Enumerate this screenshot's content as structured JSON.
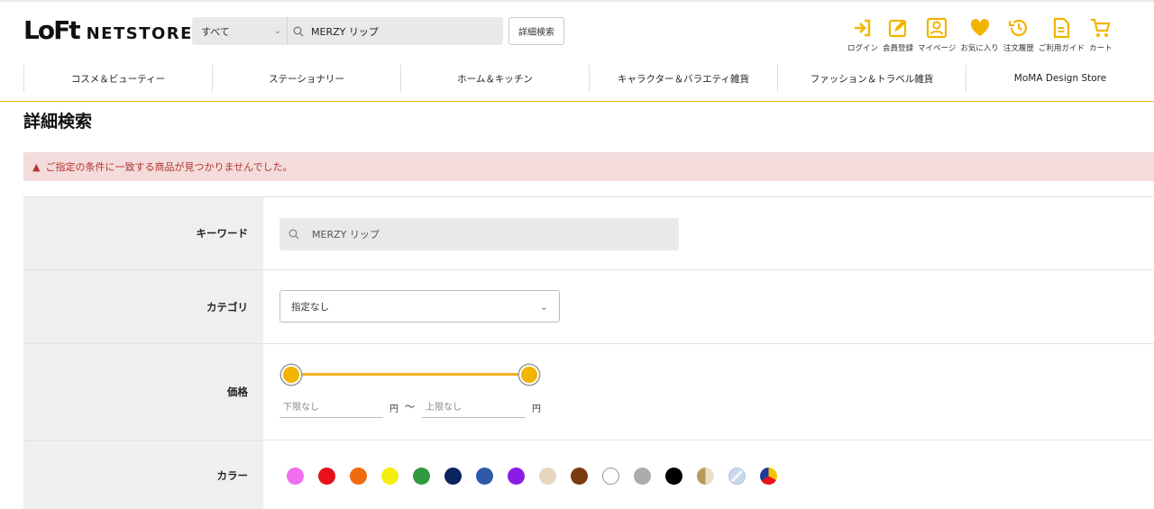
{
  "header": {
    "logo_mark": "LoFt",
    "logo_text": "NETSTORE",
    "search_scope": "すべて",
    "search_value": "MERZY リップ",
    "advanced_button": "詳細検索",
    "icons": [
      {
        "name": "login-icon",
        "label": "ログイン"
      },
      {
        "name": "register-icon",
        "label": "会員登録"
      },
      {
        "name": "mypage-icon",
        "label": "マイページ"
      },
      {
        "name": "favorite-icon",
        "label": "お気に入り"
      },
      {
        "name": "history-icon",
        "label": "注文履歴"
      },
      {
        "name": "guide-icon",
        "label": "ご利用ガイド"
      },
      {
        "name": "cart-icon",
        "label": "カート"
      }
    ]
  },
  "nav": {
    "items": [
      "コスメ＆ビューティー",
      "ステーショナリー",
      "ホーム＆キッチン",
      "キャラクター＆バラエティ雑貨",
      "ファッション＆トラベル雑貨",
      "MoMA Design Store"
    ]
  },
  "page_title": "詳細検索",
  "alert": {
    "message": "ご指定の条件に一致する商品が見つかりませんでした。",
    "color": "#b4342d"
  },
  "form": {
    "keyword": {
      "label": "キーワード",
      "value": "MERZY リップ"
    },
    "category": {
      "label": "カテゴリ",
      "selected": "指定なし"
    },
    "price": {
      "label": "価格",
      "min_placeholder": "下限なし",
      "max_placeholder": "上限なし",
      "unit": "円",
      "separator": "〜"
    },
    "color": {
      "label": "カラー",
      "swatches": [
        "pink",
        "red",
        "orange",
        "yellow",
        "green",
        "navy",
        "blue",
        "purple",
        "beige",
        "brown",
        "white",
        "gray",
        "black",
        "gold",
        "silver",
        "multi"
      ]
    }
  },
  "theme": {
    "accent": "#f3b400"
  }
}
